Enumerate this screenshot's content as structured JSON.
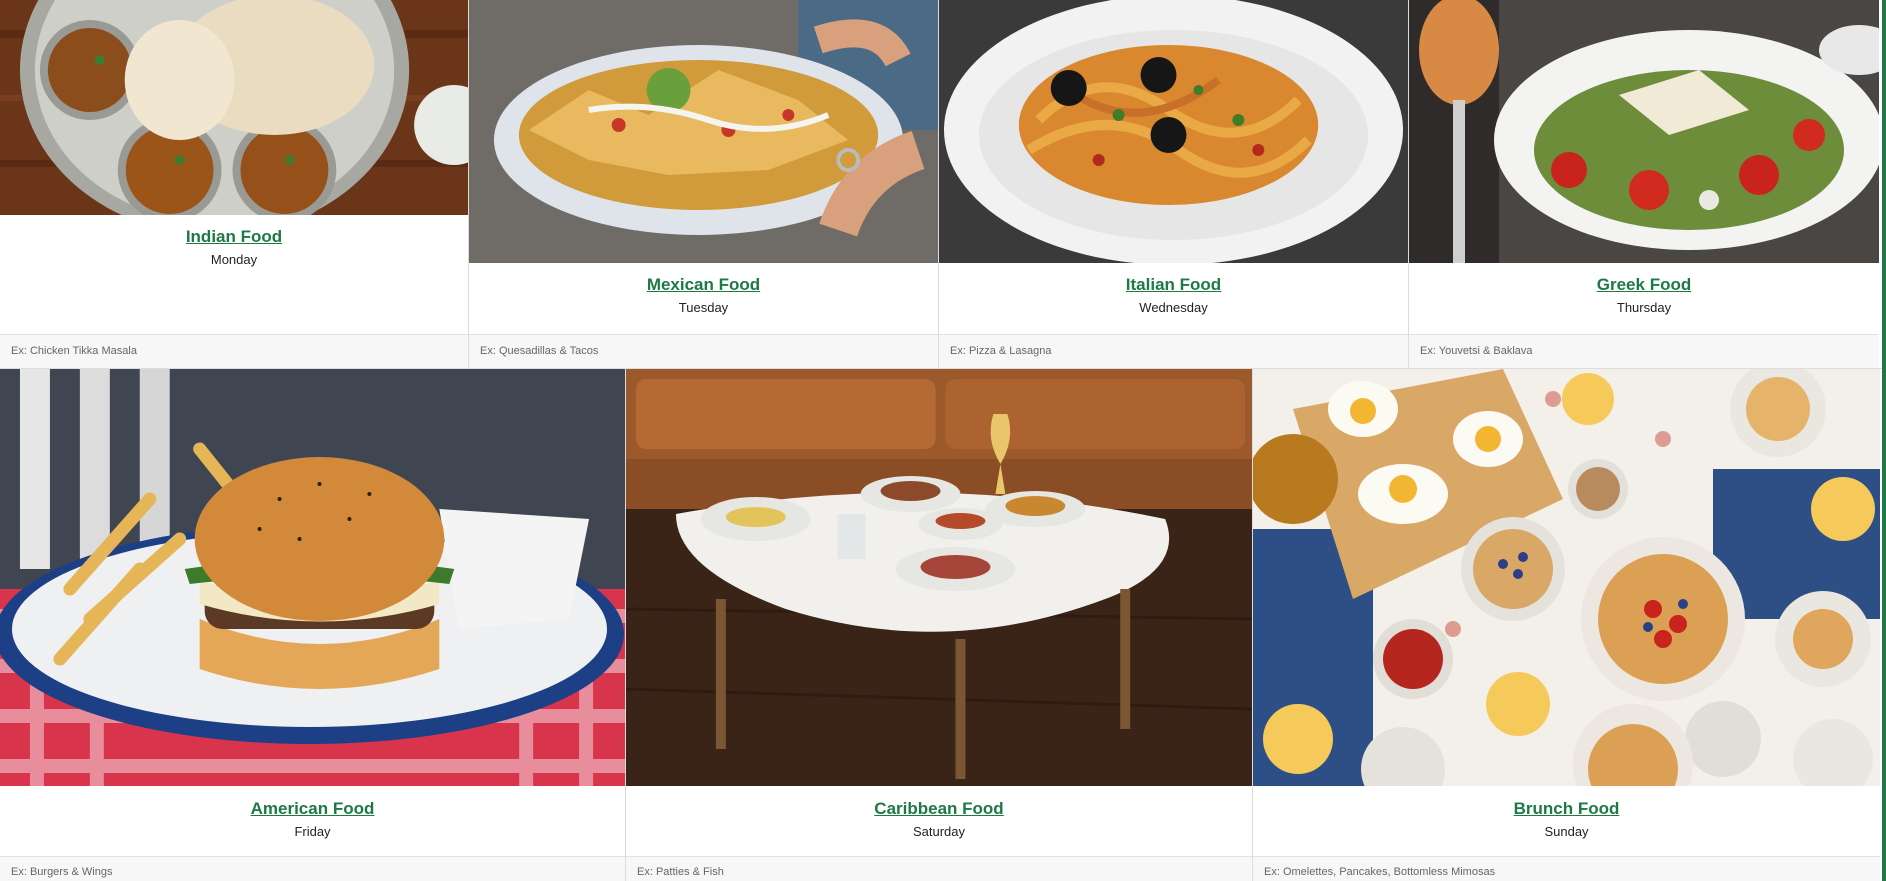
{
  "cards_row1": [
    {
      "title": "Indian Food",
      "day": "Monday",
      "example": "Ex: Chicken Tikka Masala",
      "image_icon": "indian-thali-photo"
    },
    {
      "title": "Mexican Food",
      "day": "Tuesday",
      "example": "Ex: Quesadillas & Tacos",
      "image_icon": "nachos-photo"
    },
    {
      "title": "Italian Food",
      "day": "Wednesday",
      "example": "Ex: Pizza & Lasagna",
      "image_icon": "pasta-photo"
    },
    {
      "title": "Greek Food",
      "day": "Thursday",
      "example": "Ex: Youvetsi & Baklava",
      "image_icon": "greek-salad-photo"
    }
  ],
  "cards_row2": [
    {
      "title": "American Food",
      "day": "Friday",
      "example": "Ex: Burgers & Wings",
      "image_icon": "burger-fries-photo"
    },
    {
      "title": "Caribbean Food",
      "day": "Saturday",
      "example": "Ex: Patties & Fish",
      "image_icon": "caribbean-table-photo"
    },
    {
      "title": "Brunch Food",
      "day": "Sunday",
      "example": "Ex: Omelettes, Pancakes, Bottomless Mimosas",
      "image_icon": "brunch-spread-photo"
    }
  ],
  "colors": {
    "link": "#1d7a45",
    "footer_bg": "#f7f7f7",
    "border": "#dcdcdc"
  }
}
